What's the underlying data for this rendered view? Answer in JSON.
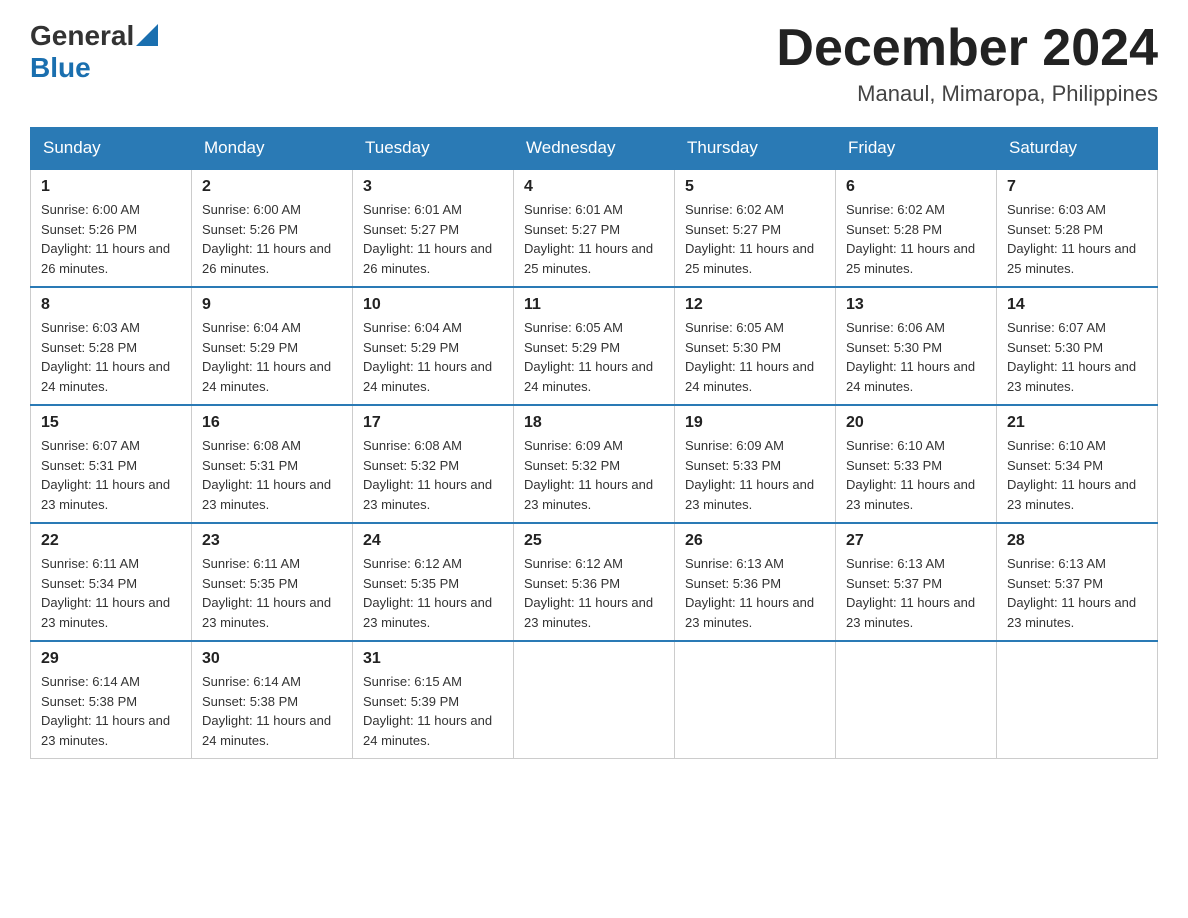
{
  "header": {
    "logo": {
      "text1": "General",
      "text2": "Blue"
    },
    "title": "December 2024",
    "location": "Manaul, Mimaropa, Philippines"
  },
  "calendar": {
    "days_of_week": [
      "Sunday",
      "Monday",
      "Tuesday",
      "Wednesday",
      "Thursday",
      "Friday",
      "Saturday"
    ],
    "weeks": [
      [
        {
          "day": "1",
          "sunrise": "6:00 AM",
          "sunset": "5:26 PM",
          "daylight": "11 hours and 26 minutes."
        },
        {
          "day": "2",
          "sunrise": "6:00 AM",
          "sunset": "5:26 PM",
          "daylight": "11 hours and 26 minutes."
        },
        {
          "day": "3",
          "sunrise": "6:01 AM",
          "sunset": "5:27 PM",
          "daylight": "11 hours and 26 minutes."
        },
        {
          "day": "4",
          "sunrise": "6:01 AM",
          "sunset": "5:27 PM",
          "daylight": "11 hours and 25 minutes."
        },
        {
          "day": "5",
          "sunrise": "6:02 AM",
          "sunset": "5:27 PM",
          "daylight": "11 hours and 25 minutes."
        },
        {
          "day": "6",
          "sunrise": "6:02 AM",
          "sunset": "5:28 PM",
          "daylight": "11 hours and 25 minutes."
        },
        {
          "day": "7",
          "sunrise": "6:03 AM",
          "sunset": "5:28 PM",
          "daylight": "11 hours and 25 minutes."
        }
      ],
      [
        {
          "day": "8",
          "sunrise": "6:03 AM",
          "sunset": "5:28 PM",
          "daylight": "11 hours and 24 minutes."
        },
        {
          "day": "9",
          "sunrise": "6:04 AM",
          "sunset": "5:29 PM",
          "daylight": "11 hours and 24 minutes."
        },
        {
          "day": "10",
          "sunrise": "6:04 AM",
          "sunset": "5:29 PM",
          "daylight": "11 hours and 24 minutes."
        },
        {
          "day": "11",
          "sunrise": "6:05 AM",
          "sunset": "5:29 PM",
          "daylight": "11 hours and 24 minutes."
        },
        {
          "day": "12",
          "sunrise": "6:05 AM",
          "sunset": "5:30 PM",
          "daylight": "11 hours and 24 minutes."
        },
        {
          "day": "13",
          "sunrise": "6:06 AM",
          "sunset": "5:30 PM",
          "daylight": "11 hours and 24 minutes."
        },
        {
          "day": "14",
          "sunrise": "6:07 AM",
          "sunset": "5:30 PM",
          "daylight": "11 hours and 23 minutes."
        }
      ],
      [
        {
          "day": "15",
          "sunrise": "6:07 AM",
          "sunset": "5:31 PM",
          "daylight": "11 hours and 23 minutes."
        },
        {
          "day": "16",
          "sunrise": "6:08 AM",
          "sunset": "5:31 PM",
          "daylight": "11 hours and 23 minutes."
        },
        {
          "day": "17",
          "sunrise": "6:08 AM",
          "sunset": "5:32 PM",
          "daylight": "11 hours and 23 minutes."
        },
        {
          "day": "18",
          "sunrise": "6:09 AM",
          "sunset": "5:32 PM",
          "daylight": "11 hours and 23 minutes."
        },
        {
          "day": "19",
          "sunrise": "6:09 AM",
          "sunset": "5:33 PM",
          "daylight": "11 hours and 23 minutes."
        },
        {
          "day": "20",
          "sunrise": "6:10 AM",
          "sunset": "5:33 PM",
          "daylight": "11 hours and 23 minutes."
        },
        {
          "day": "21",
          "sunrise": "6:10 AM",
          "sunset": "5:34 PM",
          "daylight": "11 hours and 23 minutes."
        }
      ],
      [
        {
          "day": "22",
          "sunrise": "6:11 AM",
          "sunset": "5:34 PM",
          "daylight": "11 hours and 23 minutes."
        },
        {
          "day": "23",
          "sunrise": "6:11 AM",
          "sunset": "5:35 PM",
          "daylight": "11 hours and 23 minutes."
        },
        {
          "day": "24",
          "sunrise": "6:12 AM",
          "sunset": "5:35 PM",
          "daylight": "11 hours and 23 minutes."
        },
        {
          "day": "25",
          "sunrise": "6:12 AM",
          "sunset": "5:36 PM",
          "daylight": "11 hours and 23 minutes."
        },
        {
          "day": "26",
          "sunrise": "6:13 AM",
          "sunset": "5:36 PM",
          "daylight": "11 hours and 23 minutes."
        },
        {
          "day": "27",
          "sunrise": "6:13 AM",
          "sunset": "5:37 PM",
          "daylight": "11 hours and 23 minutes."
        },
        {
          "day": "28",
          "sunrise": "6:13 AM",
          "sunset": "5:37 PM",
          "daylight": "11 hours and 23 minutes."
        }
      ],
      [
        {
          "day": "29",
          "sunrise": "6:14 AM",
          "sunset": "5:38 PM",
          "daylight": "11 hours and 23 minutes."
        },
        {
          "day": "30",
          "sunrise": "6:14 AM",
          "sunset": "5:38 PM",
          "daylight": "11 hours and 24 minutes."
        },
        {
          "day": "31",
          "sunrise": "6:15 AM",
          "sunset": "5:39 PM",
          "daylight": "11 hours and 24 minutes."
        },
        null,
        null,
        null,
        null
      ]
    ]
  }
}
